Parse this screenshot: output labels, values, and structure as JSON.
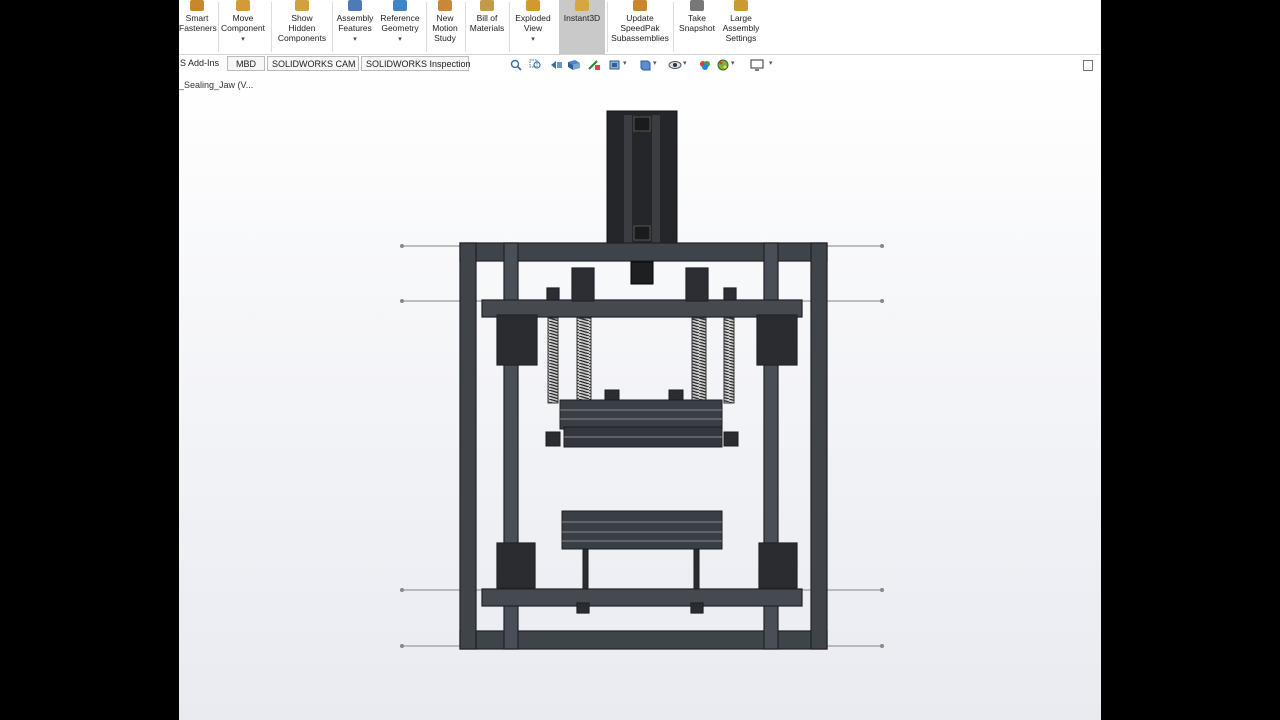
{
  "ribbon": {
    "buttons": [
      {
        "label": "Smart\nFasteners",
        "icon": "smart-fasteners-icon",
        "color": "#c8872a"
      },
      {
        "label": "Move\nComponent",
        "icon": "move-component-icon",
        "color": "#d49a38",
        "caret": "▾"
      },
      {
        "label": "Show\nHidden\nComponents",
        "icon": "show-hidden-components-icon",
        "color": "#d2a040"
      },
      {
        "label": "Assembly\nFeatures",
        "icon": "assembly-features-icon",
        "color": "#4f7ab8",
        "caret": "▾"
      },
      {
        "label": "Reference\nGeometry",
        "icon": "reference-geometry-icon",
        "color": "#3e82c8",
        "caret": "▾"
      },
      {
        "label": "New\nMotion\nStudy",
        "icon": "motion-study-icon",
        "color": "#c9873a"
      },
      {
        "label": "Bill of\nMaterials",
        "icon": "bill-of-materials-icon",
        "color": "#c29a48"
      },
      {
        "label": "Exploded\nView",
        "icon": "exploded-view-icon",
        "color": "#d09a2c",
        "caret": "▾"
      },
      {
        "label": "Instant3D",
        "icon": "instant3d-icon",
        "color": "#d6a640"
      },
      {
        "label": "Update\nSpeedPak\nSubassemblies",
        "icon": "speedpak-icon",
        "color": "#c8862e"
      },
      {
        "label": "Take\nSnapshot",
        "icon": "snapshot-icon",
        "color": "#777777"
      },
      {
        "label": "Large\nAssembly\nSettings",
        "icon": "large-assembly-settings-icon",
        "color": "#c99a34"
      }
    ]
  },
  "tabs": [
    {
      "label": "S Add-Ins"
    },
    {
      "label": "MBD"
    },
    {
      "label": "SOLIDWORKS CAM"
    },
    {
      "label": "SOLIDWORKS Inspection"
    }
  ],
  "view_toolbar": {
    "icons": [
      "zoom-to-fit-icon",
      "zoom-to-area-icon",
      "previous-view-icon",
      "section-view-icon",
      "dynamic-annotation-icon",
      "view-orientation-icon",
      "display-style-icon",
      "hide-show-items-icon",
      "edit-appearance-icon",
      "apply-scene-icon",
      "view-settings-icon"
    ]
  },
  "document": {
    "title": "_Sealing_Jaw (V..."
  },
  "colors": {
    "frame": "#3d4148",
    "frame_edge": "#22252a",
    "dark_part": "#1f2124",
    "viewport_bg": "#eef0f5",
    "active_button": "#c9c9c9"
  }
}
